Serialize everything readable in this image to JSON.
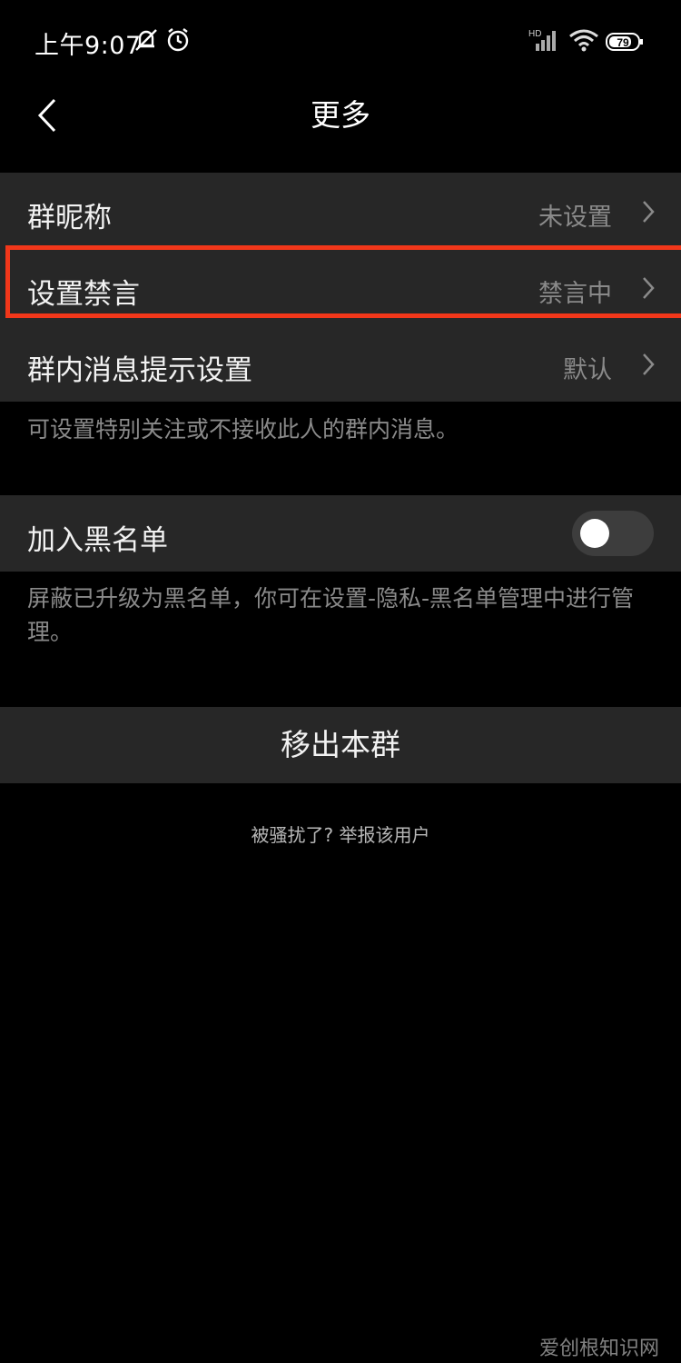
{
  "status_bar": {
    "time": "上午9:07",
    "battery": "79",
    "network": "HD"
  },
  "nav": {
    "title": "更多"
  },
  "settings": {
    "rows": [
      {
        "label": "群昵称",
        "value": "未设置"
      },
      {
        "label": "设置禁言",
        "value": "禁言中"
      },
      {
        "label": "群内消息提示设置",
        "value": "默认"
      }
    ],
    "hint": "可设置特别关注或不接收此人的群内消息。"
  },
  "blacklist": {
    "label": "加入黑名单",
    "enabled": false,
    "hint": "屏蔽已升级为黑名单，你可在设置-隐私-黑名单管理中进行管理。"
  },
  "actions": {
    "exit_label": "移出本群",
    "report_label": "被骚扰了? 举报该用户"
  },
  "watermark": "爱创根知识网",
  "colors": {
    "background": "#000000",
    "row": "#272727",
    "highlight": "#f2371a",
    "muted_text": "#8a8a8a"
  }
}
